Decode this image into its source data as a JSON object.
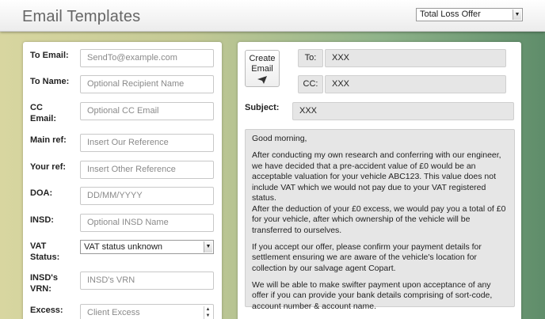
{
  "header": {
    "title": "Email Templates",
    "template_select": "Total Loss Offer"
  },
  "form": {
    "to_email": {
      "label": "To Email:",
      "placeholder": "SendTo@example.com"
    },
    "to_name": {
      "label": "To Name:",
      "placeholder": "Optional Recipient Name"
    },
    "cc_email": {
      "label_line1": "CC",
      "label_line2": "Email:",
      "placeholder": "Optional CC Email"
    },
    "main_ref": {
      "label": "Main ref:",
      "placeholder": "Insert Our Reference"
    },
    "your_ref": {
      "label": "Your ref:",
      "placeholder": "Insert Other Reference"
    },
    "doa": {
      "label": "DOA:",
      "placeholder": "DD/MM/YYYY"
    },
    "insd": {
      "label": "INSD:",
      "placeholder": "Optional INSD Name"
    },
    "vat_status": {
      "label_line1": "VAT",
      "label_line2": "Status:",
      "value": "VAT status unknown"
    },
    "insd_vrn": {
      "label_line1": "INSD's",
      "label_line2": "VRN:",
      "placeholder": "INSD's VRN"
    },
    "excess": {
      "label": "Excess:",
      "placeholder": "Client Excess"
    }
  },
  "preview": {
    "create_button_line1": "Create",
    "create_button_line2": "Email",
    "to_label": "To:",
    "to_value": "XXX",
    "cc_label": "CC:",
    "cc_value": "XXX",
    "subject_label": "Subject:",
    "subject_value": "XXX",
    "body": [
      "Good morning,",
      "After conducting my own research and conferring with our engineer, we have decided that a pre-accident value of £0 would be an acceptable valuation for your vehicle ABC123. This value does not include VAT which we would not pay due to your VAT registered status.\nAfter the deduction of your £0 excess, we would pay you a total of £0 for your vehicle, after which ownership of the vehicle will be transferred to ourselves.",
      "If you accept our offer, please confirm your payment details for settlement ensuring we are aware of the vehicle's location for collection by our salvage agent Copart.",
      "We will be able to make swifter payment upon acceptance of any offer if you can provide your bank details comprising of sort-code, account number & account name."
    ]
  },
  "icons": {
    "send": "paper-plane-icon",
    "dropdown": "chevron-down-icon",
    "spinner": "spinner-arrows-icon"
  }
}
